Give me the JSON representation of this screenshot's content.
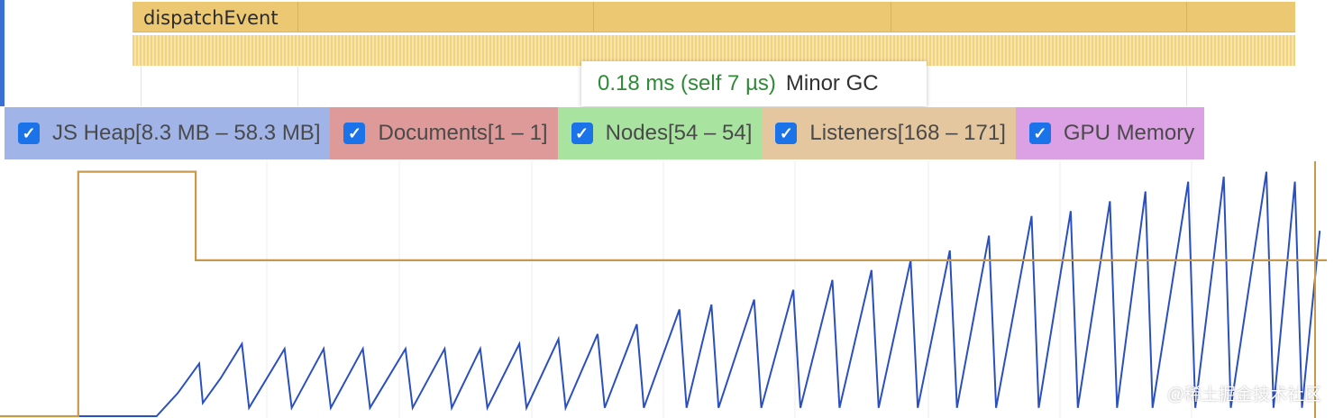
{
  "flame": {
    "slice_label": "dispatchEvent",
    "slice_color": "#ecc873"
  },
  "tooltip": {
    "duration": "0.18 ms (self 7 µs)",
    "name": "Minor GC"
  },
  "legend": [
    {
      "label": "JS Heap[8.3 MB – 58.3 MB]",
      "checked": true,
      "color": "#a0b4e8",
      "check_icon": "checkmark-icon"
    },
    {
      "label": "Documents[1 – 1]",
      "checked": true,
      "color": "#dd9a98",
      "check_icon": "checkmark-icon"
    },
    {
      "label": "Nodes[54 – 54]",
      "checked": true,
      "color": "#a8e4a0",
      "check_icon": "checkmark-icon"
    },
    {
      "label": "Listeners[168 – 171]",
      "checked": true,
      "color": "#e4c79e",
      "check_icon": "checkmark-icon"
    },
    {
      "label": "GPU Memory",
      "checked": true,
      "color": "#dca0e4",
      "check_icon": "checkmark-icon"
    }
  ],
  "chart_data": {
    "type": "line",
    "grid": true,
    "series": [
      {
        "color": "#2a4fbf",
        "points": [
          [
            0,
            8.3
          ],
          [
            30,
            8.3
          ],
          [
            44,
            8.3
          ],
          [
            50,
            13
          ],
          [
            56,
            19
          ],
          [
            57,
            11
          ],
          [
            62,
            16
          ],
          [
            68,
            23
          ],
          [
            70,
            10
          ],
          [
            80,
            22
          ],
          [
            82,
            10
          ],
          [
            91,
            22
          ],
          [
            93,
            10
          ],
          [
            102,
            22
          ],
          [
            104,
            10
          ],
          [
            114,
            22
          ],
          [
            116,
            10
          ],
          [
            125,
            22
          ],
          [
            127,
            10
          ],
          [
            135,
            22
          ],
          [
            137,
            10
          ],
          [
            146,
            23
          ],
          [
            148,
            10
          ],
          [
            157,
            24
          ],
          [
            159,
            10
          ],
          [
            168,
            25
          ],
          [
            170,
            10
          ],
          [
            179,
            27
          ],
          [
            181,
            10
          ],
          [
            191,
            30
          ],
          [
            193,
            10
          ],
          [
            200,
            31
          ],
          [
            202,
            10
          ],
          [
            212,
            32
          ],
          [
            214,
            10
          ],
          [
            223,
            34
          ],
          [
            225,
            10
          ],
          [
            234,
            36
          ],
          [
            236,
            10
          ],
          [
            245,
            38
          ],
          [
            247,
            10
          ],
          [
            256,
            40
          ],
          [
            258,
            10
          ],
          [
            267,
            42
          ],
          [
            269,
            10
          ],
          [
            278,
            45
          ],
          [
            280,
            10
          ],
          [
            290,
            49
          ],
          [
            292,
            10
          ],
          [
            301,
            50
          ],
          [
            303,
            10
          ],
          [
            312,
            52
          ],
          [
            314,
            10
          ],
          [
            322,
            54
          ],
          [
            324,
            10
          ],
          [
            334,
            56
          ],
          [
            336,
            10
          ],
          [
            344,
            57
          ],
          [
            346,
            10
          ],
          [
            356,
            58
          ],
          [
            358,
            10
          ],
          [
            364,
            56
          ],
          [
            366,
            10
          ],
          [
            371,
            46
          ]
        ]
      },
      {
        "color": "#c8994a",
        "points": [
          [
            0,
            8.3
          ],
          [
            22,
            8.3
          ],
          [
            22,
            58
          ],
          [
            55,
            58
          ],
          [
            55,
            40
          ],
          [
            373,
            40
          ]
        ]
      }
    ]
  },
  "watermark": "@稀土掘金技术社区"
}
